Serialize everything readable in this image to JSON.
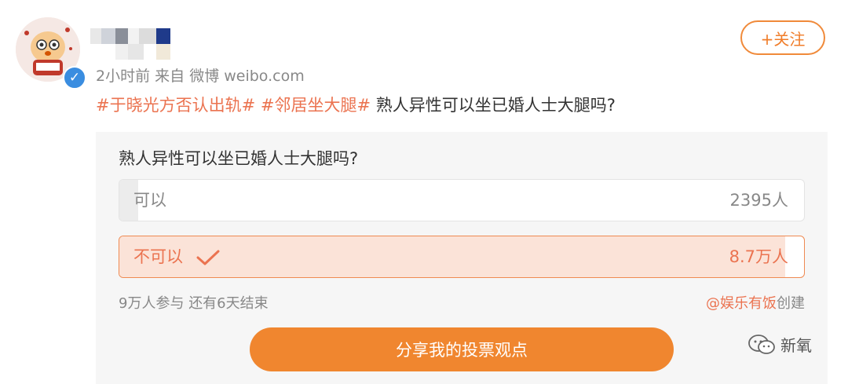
{
  "header": {
    "follow_label": "+关注",
    "time": "2小时前",
    "source_prefix": "来自",
    "source": "微博 weibo.com"
  },
  "post": {
    "tag1": "#于晓光方否认出轨#",
    "tag2": "#邻居坐大腿#",
    "text": "熟人异性可以坐已婚人士大腿吗?"
  },
  "poll": {
    "question": "熟人异性可以坐已婚人士大腿吗?",
    "options": [
      {
        "label": "可以",
        "count": "2395人",
        "share": 0.027,
        "selected": false
      },
      {
        "label": "不可以",
        "count": "8.7万人",
        "share": 0.973,
        "selected": true
      }
    ],
    "participants": "9万人参与",
    "remaining": "还有6天结束",
    "creator": "@娱乐有饭",
    "creator_suffix": "创建",
    "share_label": "分享我的投票观点"
  },
  "watermark": {
    "text": "新氧"
  },
  "colors": {
    "accent": "#f0862f",
    "link": "#eb7350",
    "verified": "#3a8de0"
  }
}
